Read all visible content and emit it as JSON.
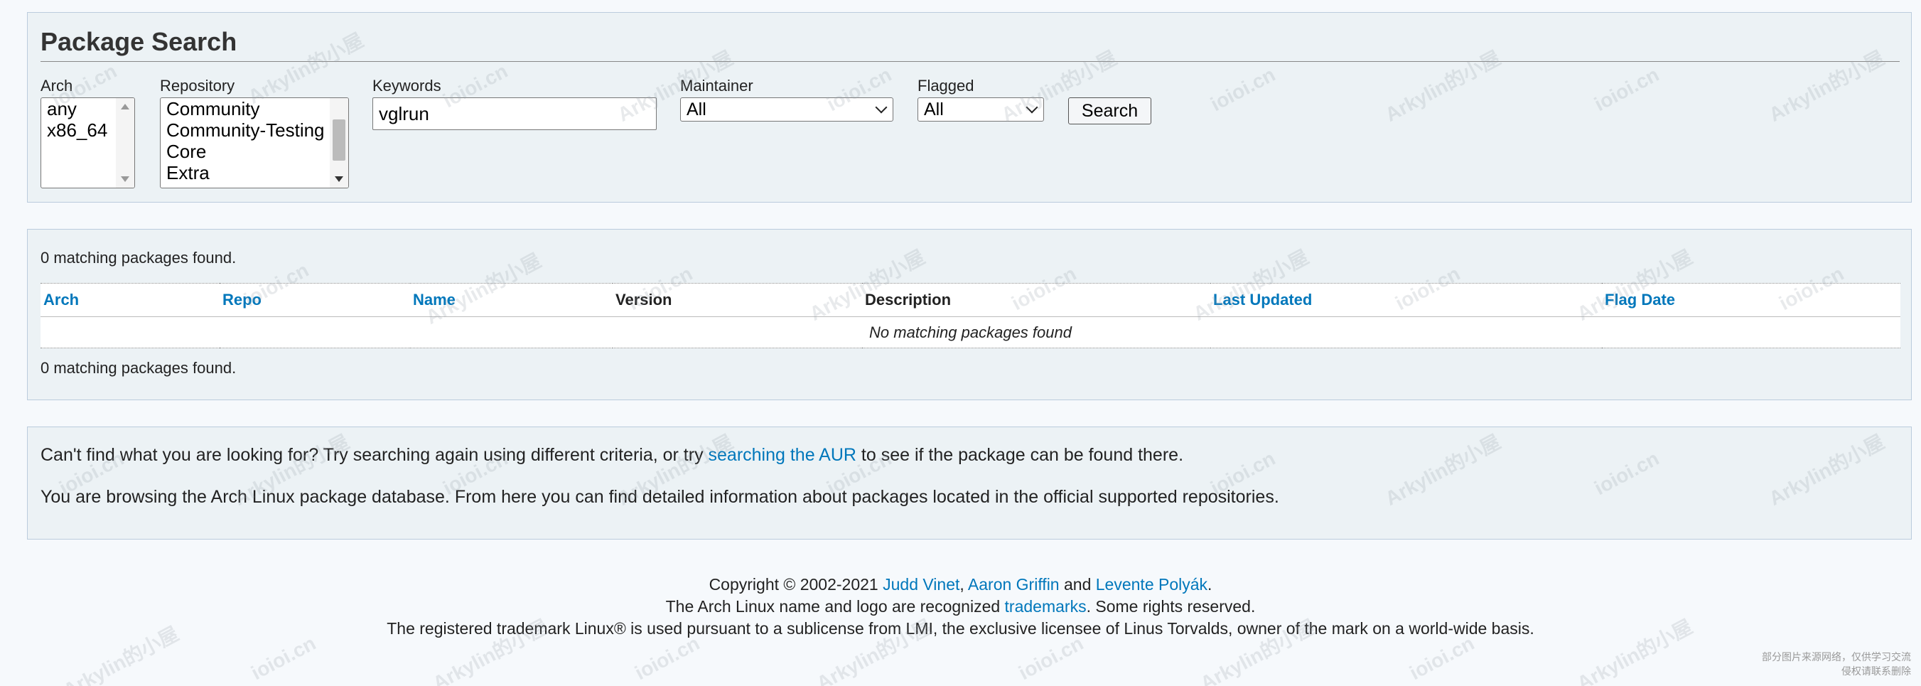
{
  "search": {
    "title": "Package Search",
    "arch_label": "Arch",
    "arch_options": [
      "any",
      "x86_64"
    ],
    "repository_label": "Repository",
    "repository_options": [
      "Community",
      "Community-Testing",
      "Core",
      "Extra"
    ],
    "keywords_label": "Keywords",
    "keywords_value": "vglrun",
    "maintainer_label": "Maintainer",
    "maintainer_value": "All",
    "flagged_label": "Flagged",
    "flagged_value": "All",
    "search_button": "Search"
  },
  "results": {
    "count_top": "0 matching packages found.",
    "columns": [
      "Arch",
      "Repo",
      "Name",
      "Version",
      "Description",
      "Last Updated",
      "Flag Date"
    ],
    "sortable_columns": [
      "Arch",
      "Repo",
      "Name",
      "Last Updated",
      "Flag Date"
    ],
    "empty_message": "No matching packages found",
    "count_bottom": "0 matching packages found."
  },
  "info": {
    "line1_before": "Can't find what you are looking for? Try searching again using different criteria, or try ",
    "line1_link": "searching the AUR",
    "line1_after": " to see if the package can be found there.",
    "line2": "You are browsing the Arch Linux package database. From here you can find detailed information about packages located in the official supported repositories."
  },
  "footer": {
    "copyright": "Copyright © 2002-2021 ",
    "author1": "Judd Vinet",
    "sep1": ", ",
    "author2": "Aaron Griffin",
    "sep2": " and ",
    "author3": "Levente Polyák",
    "end1": ".",
    "line2_before": "The Arch Linux name and logo are recognized ",
    "line2_link": "trademarks",
    "line2_after": ". Some rights reserved.",
    "line3": "The registered trademark Linux® is used pursuant to a sublicense from LMI, the exclusive licensee of Linus Torvalds, owner of the mark on a world-wide basis."
  },
  "corner_note": {
    "line1": "部分图片来源网络，仅供学习交流",
    "line2": "侵权请联系删除"
  },
  "watermarks": [
    "Arkylin的小屋",
    "ioioi.cn"
  ]
}
